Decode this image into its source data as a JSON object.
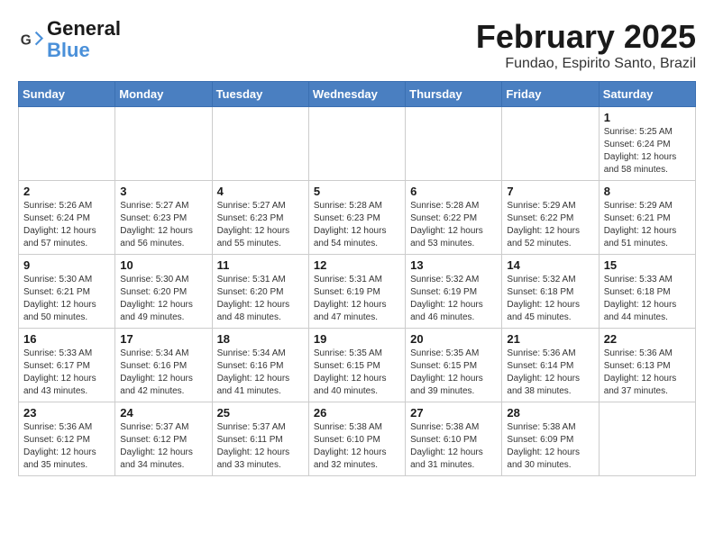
{
  "header": {
    "logo_line1": "General",
    "logo_line2": "Blue",
    "title": "February 2025",
    "subtitle": "Fundao, Espirito Santo, Brazil"
  },
  "weekdays": [
    "Sunday",
    "Monday",
    "Tuesday",
    "Wednesday",
    "Thursday",
    "Friday",
    "Saturday"
  ],
  "weeks": [
    [
      {
        "day": "",
        "info": ""
      },
      {
        "day": "",
        "info": ""
      },
      {
        "day": "",
        "info": ""
      },
      {
        "day": "",
        "info": ""
      },
      {
        "day": "",
        "info": ""
      },
      {
        "day": "",
        "info": ""
      },
      {
        "day": "1",
        "info": "Sunrise: 5:25 AM\nSunset: 6:24 PM\nDaylight: 12 hours and 58 minutes."
      }
    ],
    [
      {
        "day": "2",
        "info": "Sunrise: 5:26 AM\nSunset: 6:24 PM\nDaylight: 12 hours and 57 minutes."
      },
      {
        "day": "3",
        "info": "Sunrise: 5:27 AM\nSunset: 6:23 PM\nDaylight: 12 hours and 56 minutes."
      },
      {
        "day": "4",
        "info": "Sunrise: 5:27 AM\nSunset: 6:23 PM\nDaylight: 12 hours and 55 minutes."
      },
      {
        "day": "5",
        "info": "Sunrise: 5:28 AM\nSunset: 6:23 PM\nDaylight: 12 hours and 54 minutes."
      },
      {
        "day": "6",
        "info": "Sunrise: 5:28 AM\nSunset: 6:22 PM\nDaylight: 12 hours and 53 minutes."
      },
      {
        "day": "7",
        "info": "Sunrise: 5:29 AM\nSunset: 6:22 PM\nDaylight: 12 hours and 52 minutes."
      },
      {
        "day": "8",
        "info": "Sunrise: 5:29 AM\nSunset: 6:21 PM\nDaylight: 12 hours and 51 minutes."
      }
    ],
    [
      {
        "day": "9",
        "info": "Sunrise: 5:30 AM\nSunset: 6:21 PM\nDaylight: 12 hours and 50 minutes."
      },
      {
        "day": "10",
        "info": "Sunrise: 5:30 AM\nSunset: 6:20 PM\nDaylight: 12 hours and 49 minutes."
      },
      {
        "day": "11",
        "info": "Sunrise: 5:31 AM\nSunset: 6:20 PM\nDaylight: 12 hours and 48 minutes."
      },
      {
        "day": "12",
        "info": "Sunrise: 5:31 AM\nSunset: 6:19 PM\nDaylight: 12 hours and 47 minutes."
      },
      {
        "day": "13",
        "info": "Sunrise: 5:32 AM\nSunset: 6:19 PM\nDaylight: 12 hours and 46 minutes."
      },
      {
        "day": "14",
        "info": "Sunrise: 5:32 AM\nSunset: 6:18 PM\nDaylight: 12 hours and 45 minutes."
      },
      {
        "day": "15",
        "info": "Sunrise: 5:33 AM\nSunset: 6:18 PM\nDaylight: 12 hours and 44 minutes."
      }
    ],
    [
      {
        "day": "16",
        "info": "Sunrise: 5:33 AM\nSunset: 6:17 PM\nDaylight: 12 hours and 43 minutes."
      },
      {
        "day": "17",
        "info": "Sunrise: 5:34 AM\nSunset: 6:16 PM\nDaylight: 12 hours and 42 minutes."
      },
      {
        "day": "18",
        "info": "Sunrise: 5:34 AM\nSunset: 6:16 PM\nDaylight: 12 hours and 41 minutes."
      },
      {
        "day": "19",
        "info": "Sunrise: 5:35 AM\nSunset: 6:15 PM\nDaylight: 12 hours and 40 minutes."
      },
      {
        "day": "20",
        "info": "Sunrise: 5:35 AM\nSunset: 6:15 PM\nDaylight: 12 hours and 39 minutes."
      },
      {
        "day": "21",
        "info": "Sunrise: 5:36 AM\nSunset: 6:14 PM\nDaylight: 12 hours and 38 minutes."
      },
      {
        "day": "22",
        "info": "Sunrise: 5:36 AM\nSunset: 6:13 PM\nDaylight: 12 hours and 37 minutes."
      }
    ],
    [
      {
        "day": "23",
        "info": "Sunrise: 5:36 AM\nSunset: 6:12 PM\nDaylight: 12 hours and 35 minutes."
      },
      {
        "day": "24",
        "info": "Sunrise: 5:37 AM\nSunset: 6:12 PM\nDaylight: 12 hours and 34 minutes."
      },
      {
        "day": "25",
        "info": "Sunrise: 5:37 AM\nSunset: 6:11 PM\nDaylight: 12 hours and 33 minutes."
      },
      {
        "day": "26",
        "info": "Sunrise: 5:38 AM\nSunset: 6:10 PM\nDaylight: 12 hours and 32 minutes."
      },
      {
        "day": "27",
        "info": "Sunrise: 5:38 AM\nSunset: 6:10 PM\nDaylight: 12 hours and 31 minutes."
      },
      {
        "day": "28",
        "info": "Sunrise: 5:38 AM\nSunset: 6:09 PM\nDaylight: 12 hours and 30 minutes."
      },
      {
        "day": "",
        "info": ""
      }
    ]
  ]
}
